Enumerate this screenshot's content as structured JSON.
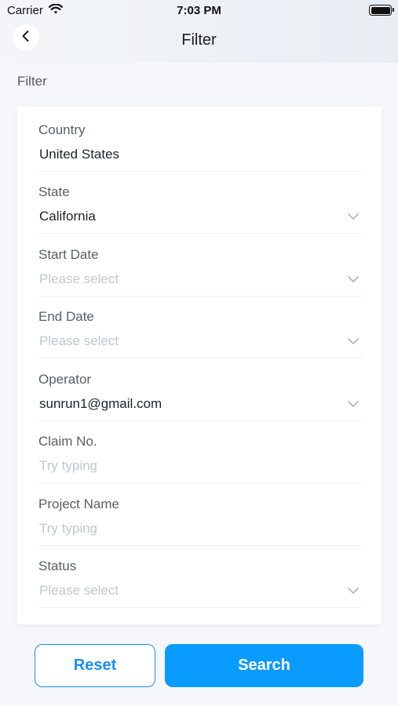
{
  "status_bar": {
    "carrier": "Carrier",
    "time": "7:03 PM"
  },
  "nav": {
    "title": "Filter",
    "back_icon": "chevron-left-icon"
  },
  "section": {
    "label": "Filter"
  },
  "fields": [
    {
      "label": "Country",
      "value": "United States",
      "placeholder": false,
      "has_dropdown": false
    },
    {
      "label": "State",
      "value": "California",
      "placeholder": false,
      "has_dropdown": true
    },
    {
      "label": "Start Date",
      "value": "Please select",
      "placeholder": true,
      "has_dropdown": true
    },
    {
      "label": "End Date",
      "value": "Please select",
      "placeholder": true,
      "has_dropdown": true
    },
    {
      "label": "Operator",
      "value": "sunrun1@gmail.com",
      "placeholder": false,
      "has_dropdown": true
    },
    {
      "label": "Claim No.",
      "value": "Try typing",
      "placeholder": true,
      "has_dropdown": false
    },
    {
      "label": "Project Name",
      "value": "Try typing",
      "placeholder": true,
      "has_dropdown": false
    },
    {
      "label": "Status",
      "value": "Please select",
      "placeholder": true,
      "has_dropdown": true
    }
  ],
  "actions": {
    "reset_label": "Reset",
    "search_label": "Search"
  },
  "colors": {
    "accent": "#0a9bff",
    "accent_border": "#1a8ff5",
    "placeholder": "#c3c6ca"
  }
}
